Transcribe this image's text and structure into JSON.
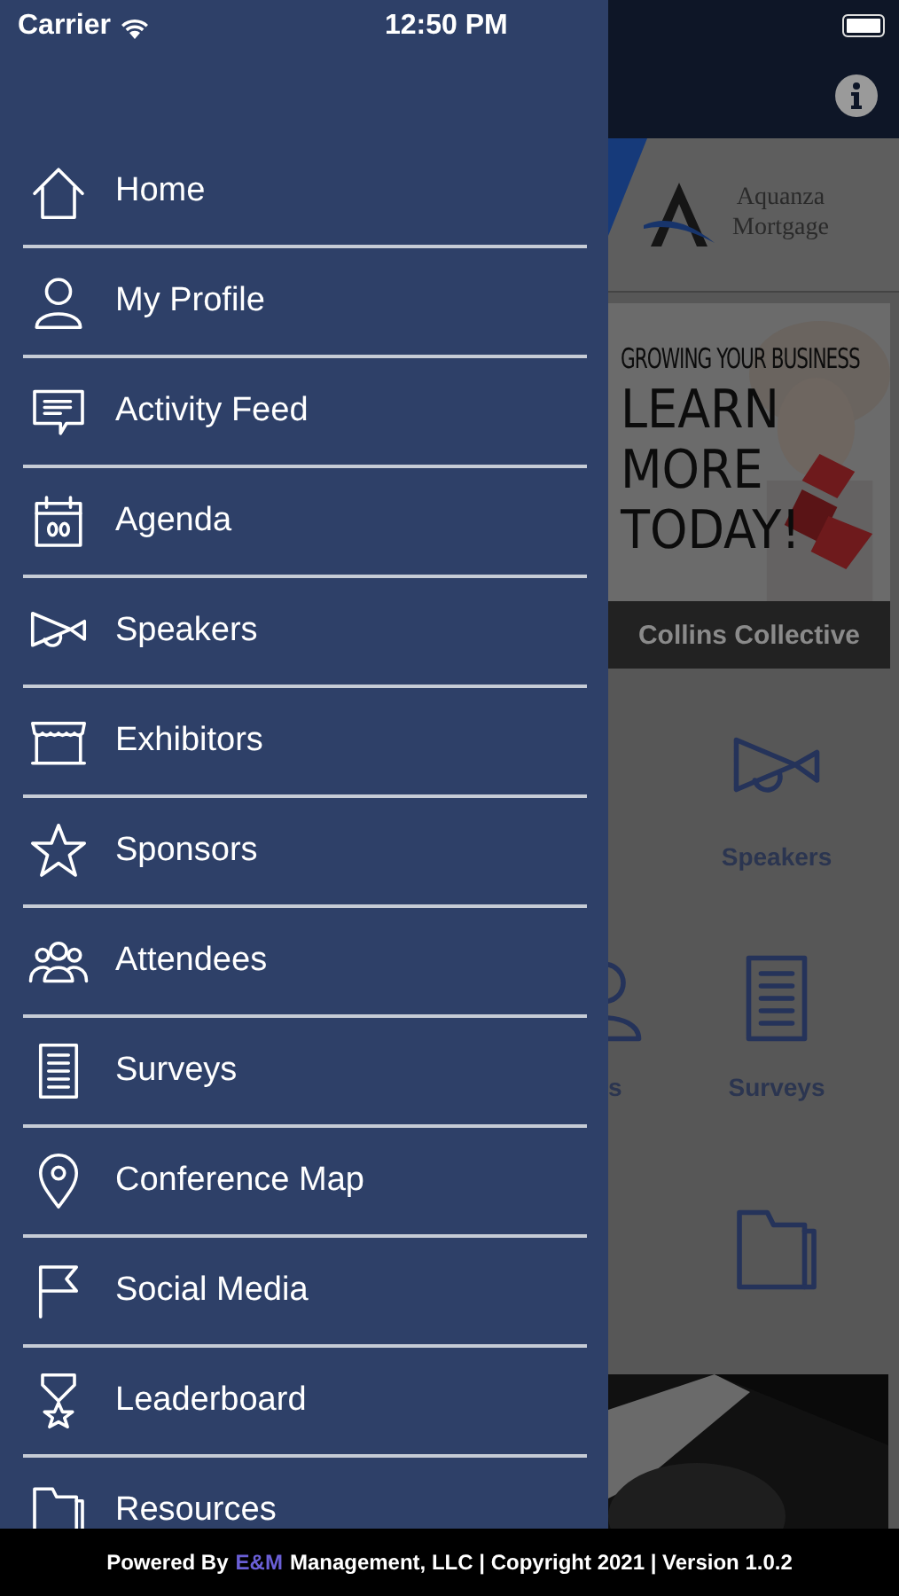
{
  "status_bar": {
    "carrier": "Carrier",
    "time": "12:50 PM"
  },
  "drawer": {
    "items": [
      {
        "label": "Home",
        "kind": "home"
      },
      {
        "label": "My Profile",
        "kind": "person"
      },
      {
        "label": "Activity Feed",
        "kind": "chat"
      },
      {
        "label": "Agenda",
        "kind": "calendar"
      },
      {
        "label": "Speakers",
        "kind": "megaphone"
      },
      {
        "label": "Exhibitors",
        "kind": "booth"
      },
      {
        "label": "Sponsors",
        "kind": "star"
      },
      {
        "label": "Attendees",
        "kind": "group"
      },
      {
        "label": "Surveys",
        "kind": "document"
      },
      {
        "label": "Conference Map",
        "kind": "pin"
      },
      {
        "label": "Social Media",
        "kind": "flag"
      },
      {
        "label": "Leaderboard",
        "kind": "medal"
      },
      {
        "label": "Resources",
        "kind": "folder"
      }
    ]
  },
  "main": {
    "sponsor": {
      "line1": "Aquanza",
      "line2": "Mortgage"
    },
    "ad": {
      "tagline": "GROWING YOUR BUSINESS",
      "headline": [
        "LEARN",
        "MORE",
        "TODAY!"
      ],
      "caption": "Collins Collective"
    },
    "tiles": [
      {
        "label": "Speakers",
        "kind": "megaphone"
      },
      {
        "label": "s",
        "kind": "person"
      },
      {
        "label": "Surveys",
        "kind": "document"
      },
      {
        "kind": "folder"
      }
    ]
  },
  "footer": {
    "prefix": "Powered By",
    "brand": "E&M",
    "suffix": "Management, LLC | Copyright 2021 | Version 1.0.2"
  }
}
